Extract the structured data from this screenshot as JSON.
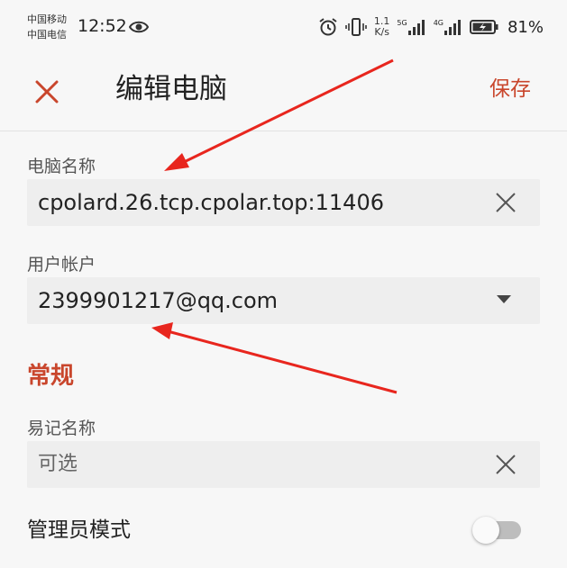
{
  "status_bar": {
    "carrier_1": "中国移动",
    "carrier_2": "中国电信",
    "time": "12:52",
    "net_speed_value": "1.1",
    "net_speed_unit": "K/s",
    "signal_1_type": "5G",
    "signal_2_type": "4G",
    "battery_percent": "81%",
    "icons": [
      "eye-icon",
      "alarm-icon",
      "vibrate-icon",
      "signal-5g-icon",
      "signal-4g-icon",
      "battery-charging-icon"
    ]
  },
  "app_bar": {
    "title": "编辑电脑",
    "save_label": "保存",
    "close_icon": "close-icon"
  },
  "form": {
    "computer_name": {
      "label": "电脑名称",
      "value": "cpolard.26.tcp.cpolar.top:11406"
    },
    "user_account": {
      "label": "用户帐户",
      "value": "2399901217@qq.com"
    },
    "general_heading": "常规",
    "friendly_name": {
      "label": "易记名称",
      "placeholder": "可选",
      "value": ""
    },
    "admin_mode": {
      "label": "管理员模式",
      "enabled": false
    }
  },
  "colors": {
    "accent": "#c9462c",
    "annotation_arrow": "#e8261e",
    "background": "#f7f7f7",
    "field_background": "#eeeeee"
  }
}
